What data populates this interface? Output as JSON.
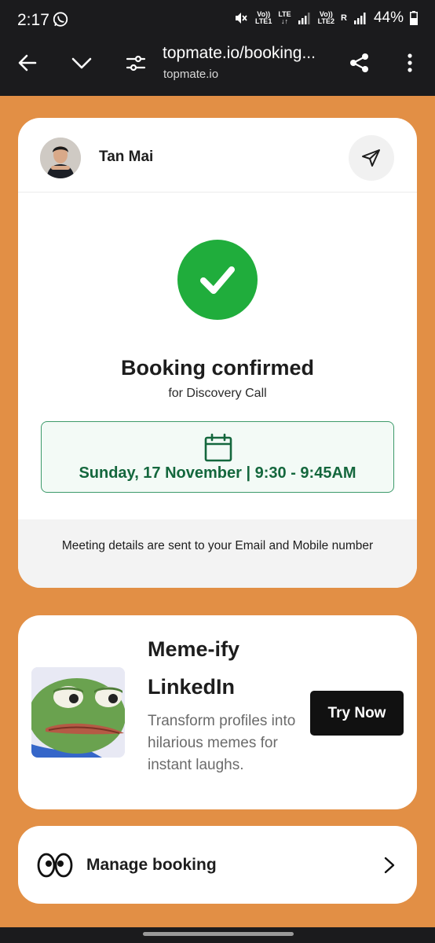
{
  "status_bar": {
    "time": "2:17",
    "lte1_top": "Vo))",
    "lte1_bottom": "LTE1",
    "lte_top": "LTE",
    "lte_bottom": "↓↑",
    "lte2_top": "Vo))",
    "lte2_bottom": "LTE2",
    "roaming": "R",
    "battery": "44%",
    "icons": [
      "whatsapp-icon",
      "mute-icon",
      "signal-icon",
      "battery-icon"
    ]
  },
  "browser": {
    "url": "topmate.io/booking...",
    "domain": "topmate.io",
    "icons": [
      "back-arrow-icon",
      "chevron-down-icon",
      "tune-icon",
      "share-icon",
      "more-vert-icon"
    ]
  },
  "booking": {
    "host_name": "Tan Mai",
    "title": "Booking confirmed",
    "subtitle": "for Discovery Call",
    "datetime": "Sunday, 17 November | 9:30 - 9:45AM",
    "footer_note": "Meeting details are sent to your Email and Mobile number"
  },
  "promo": {
    "title_line1": "Meme-ify",
    "title_line2": "LinkedIn",
    "description": "Transform profiles into hilarious memes for instant laughs.",
    "button_label": "Try Now"
  },
  "manage": {
    "label": "Manage booking"
  },
  "colors": {
    "page_background": "#e28f45",
    "success_green": "#20ad3c",
    "date_text_green": "#14673d",
    "bars_dark": "#1b1b1d"
  }
}
